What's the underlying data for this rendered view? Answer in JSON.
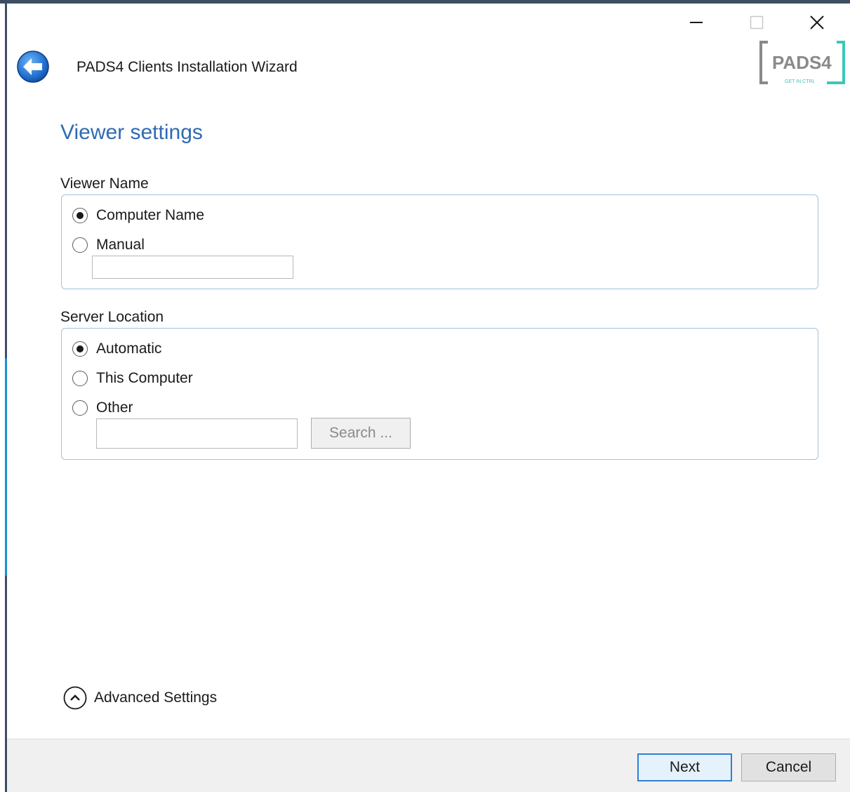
{
  "window": {
    "controls": {
      "minimize": "minimize-icon",
      "maximize": "maximize-icon",
      "close": "close-icon"
    }
  },
  "header": {
    "back_icon": "back-arrow-icon",
    "title": "PADS4 Clients Installation Wizard",
    "logo": {
      "text": "PADS4",
      "tagline": "GET IN CTRL"
    }
  },
  "page": {
    "title": "Viewer settings"
  },
  "viewer_name": {
    "label": "Viewer Name",
    "options": [
      {
        "label": "Computer Name",
        "selected": true
      },
      {
        "label": "Manual",
        "selected": false
      }
    ],
    "manual_value": ""
  },
  "server_location": {
    "label": "Server Location",
    "options": [
      {
        "label": "Automatic",
        "selected": true
      },
      {
        "label": "This Computer",
        "selected": false
      },
      {
        "label": "Other",
        "selected": false
      }
    ],
    "other_value": "",
    "search_label": "Search ..."
  },
  "advanced": {
    "label": "Advanced Settings",
    "icon": "chevron-up-icon"
  },
  "footer": {
    "next_label": "Next",
    "cancel_label": "Cancel"
  },
  "colors": {
    "title_blue": "#2e6bb3",
    "group_border": "#9fc3df",
    "logo_teal": "#3ec6b8",
    "primary_button_border": "#2f7fd3"
  }
}
